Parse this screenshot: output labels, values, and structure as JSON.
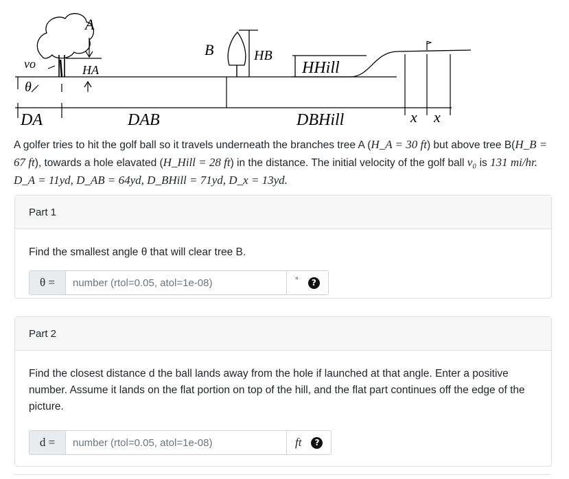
{
  "diagram": {
    "label_A": "A",
    "label_vo": "vo",
    "label_HA": "HA",
    "label_theta": "θ",
    "label_B": "B",
    "label_HB": "HB",
    "label_HHill": "HHill",
    "label_DA": "DA",
    "label_DAB": "DAB",
    "label_DBHill": "DBHill",
    "label_x1": "x",
    "label_x2": "x"
  },
  "problem": {
    "p1": "A golfer tries to hit the golf ball so it travels underneath the branches tree A (",
    "p2": "H_A = 30 ft",
    "p3": ") but above tree B(",
    "p4": "H_B = 67 ft",
    "p5": "), towards a hole elavated (",
    "p6": "H_Hill = 28 ft",
    "p7": ") in the distance. The initial velocity of the golf ball ",
    "p8": "v₀",
    "p9": " is ",
    "p10": "131 mi/hr.",
    "p11": " D_A = 11yd, D_AB = 64yd, D_BHill = 71yd, D_x = 13yd."
  },
  "part1": {
    "title": "Part 1",
    "question": "Find the smallest angle θ that will clear tree B.",
    "prefix": "θ =",
    "placeholder": "number (rtol=0.05, atol=1e-08)",
    "unit": "°",
    "help": "?"
  },
  "part2": {
    "title": "Part 2",
    "question": "Find the closest distance d the ball lands away from the hole if launched at that angle. Enter a positive number. Assume it lands on the flat portion on top of the hill, and the flat part continues off the edge of the picture.",
    "prefix": "d =",
    "placeholder": "number (rtol=0.05, atol=1e-08)",
    "unit": "ft",
    "help": "?"
  }
}
